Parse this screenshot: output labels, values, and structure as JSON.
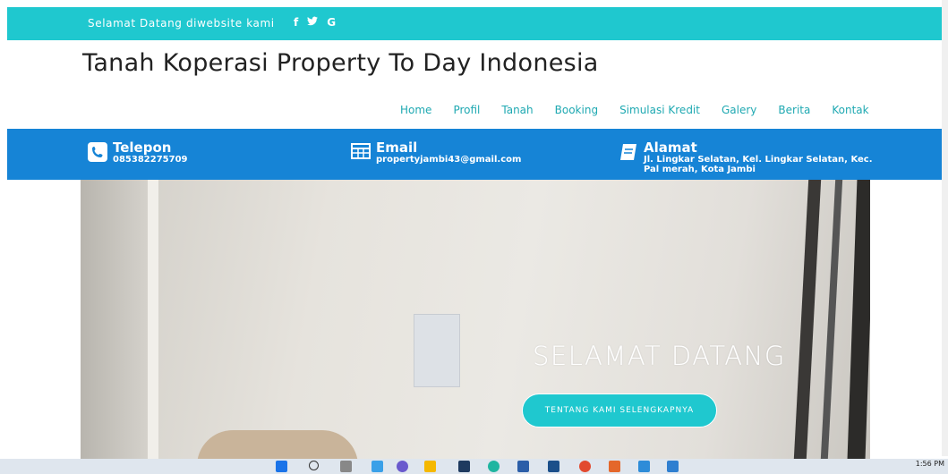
{
  "topbar": {
    "welcome": "Selamat Datang diwebsite kami",
    "social": [
      "f",
      "🐦",
      "G"
    ]
  },
  "site_title": "Tanah Koperasi Property To Day Indonesia",
  "nav": [
    "Home",
    "Profil",
    "Tanah",
    "Booking",
    "Simulasi Kredit",
    "Galery",
    "Berita",
    "Kontak"
  ],
  "info": {
    "phone": {
      "title": "Telepon",
      "value": "085382275709",
      "icon": "phone-icon"
    },
    "email": {
      "title": "Email",
      "value": "propertyjambi43@gmail.com",
      "icon": "email-icon"
    },
    "address": {
      "title": "Alamat",
      "line1": "Jl. Lingkar Selatan, Kel. Lingkar Selatan, Kec.",
      "line2": "Pal merah, Kota Jambi",
      "icon": "book-icon"
    }
  },
  "hero": {
    "headline": "SELAMAT DATANG",
    "cta": "TENTANG KAMI SELENGKAPNYA"
  },
  "taskbar": {
    "time": "1:56 PM"
  },
  "colors": {
    "teal": "#1fc8cf",
    "blue": "#1684d6"
  }
}
